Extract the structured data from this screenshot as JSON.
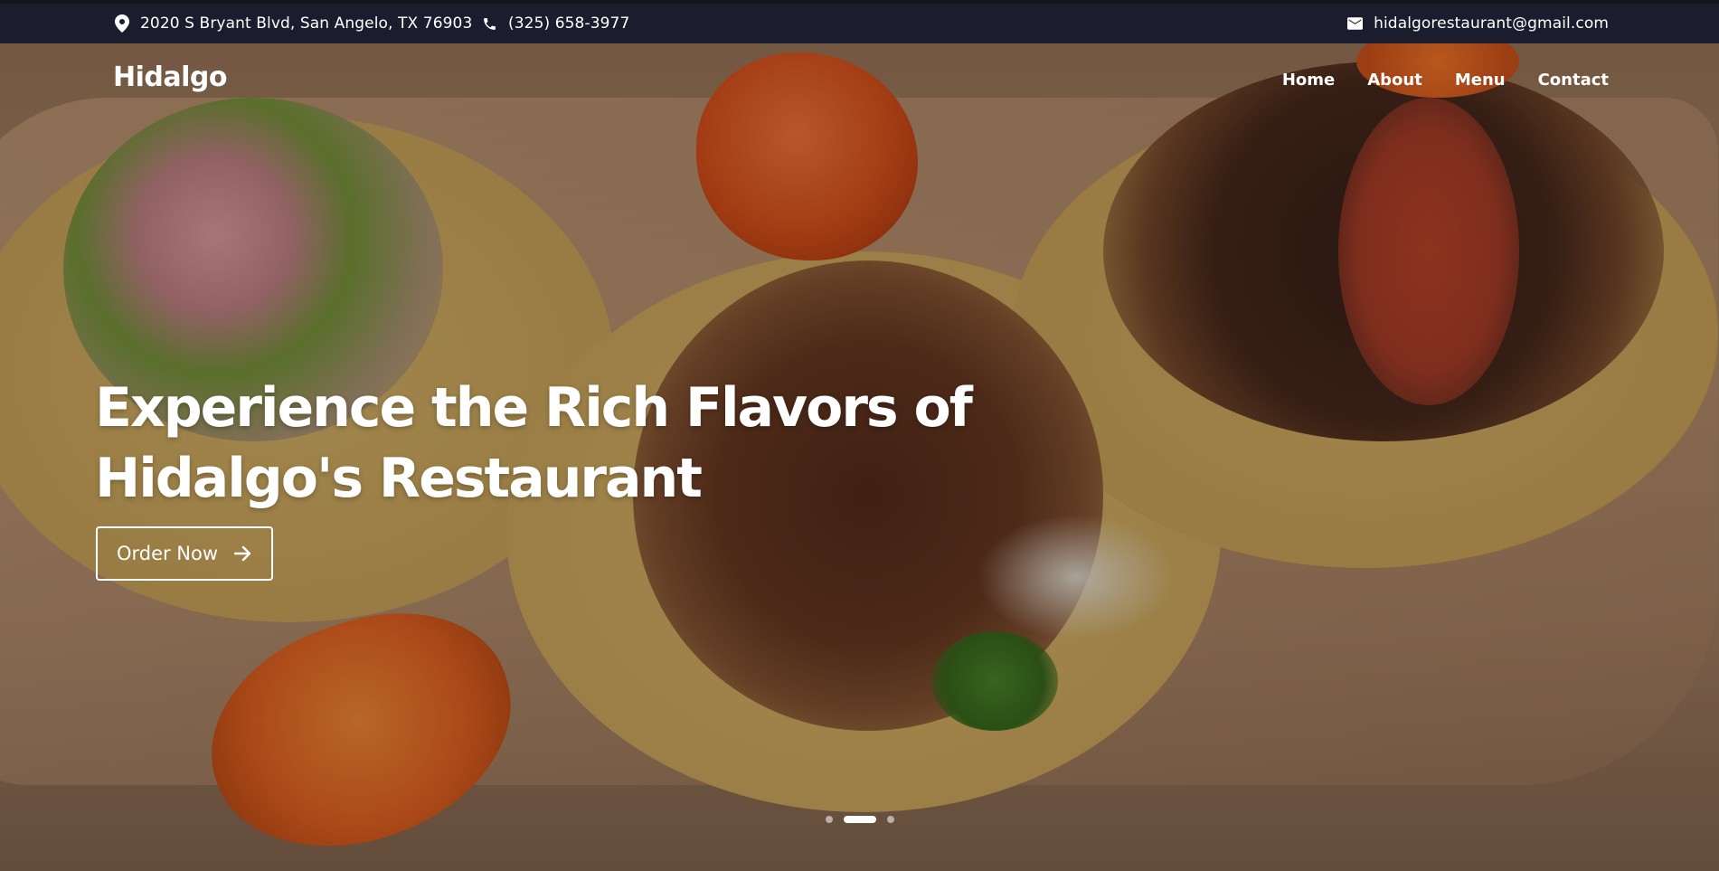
{
  "topbar": {
    "address": "2020 S Bryant Blvd, San Angelo, TX 76903",
    "phone": "(325) 658-3977",
    "email": "hidalgorestaurant@gmail.com",
    "background": "#1b1d2e"
  },
  "nav": {
    "logo": "Hidalgo",
    "items": [
      {
        "label": "Home"
      },
      {
        "label": "About"
      },
      {
        "label": "Menu"
      },
      {
        "label": "Contact"
      }
    ]
  },
  "hero": {
    "headline_line1": "Experience the Rich Flavors of",
    "headline_line2": "Hidalgo's Restaurant",
    "cta_label": "Order Now",
    "slides_total": 3,
    "active_slide": 2
  },
  "icons": {
    "address": "map-pin-icon",
    "phone": "phone-icon",
    "email": "mail-icon",
    "cta": "arrow-right-icon"
  }
}
